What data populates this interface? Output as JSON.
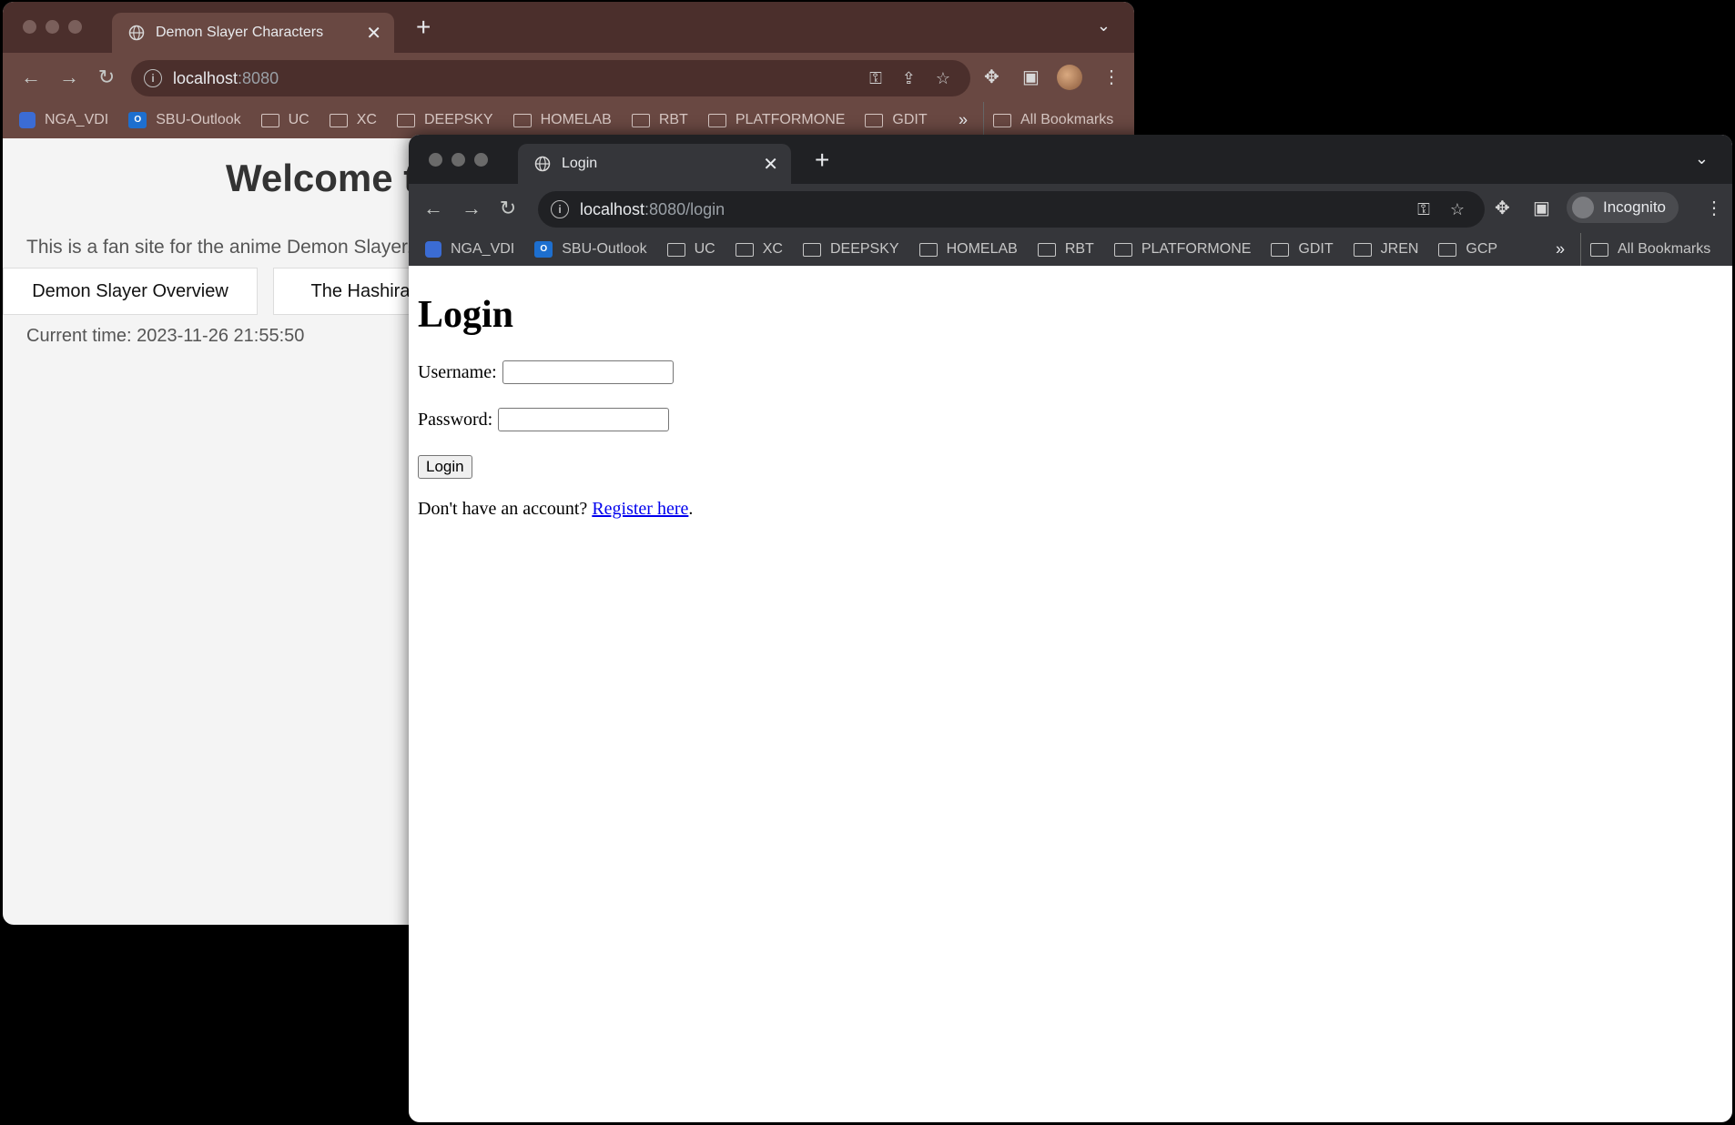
{
  "bookmarks_common": [
    "NGA_VDI",
    "SBU-Outlook",
    "UC",
    "XC",
    "DEEPSKY",
    "HOMELAB",
    "RBT",
    "PLATFORMONE",
    "GDIT"
  ],
  "back_window": {
    "tab_title": "Demon Slayer Characters",
    "url_host": "localhost",
    "url_path": ":8080",
    "all_bookmarks": "All Bookmarks",
    "page": {
      "heading": "Welcome t",
      "intro": "This is a fan site for the anime Demon Slayer.",
      "buttons": [
        "Demon Slayer Overview",
        "The Hashira"
      ],
      "time": "Current time: 2023-11-26 21:55:50"
    }
  },
  "front_window": {
    "tab_title": "Login",
    "url_host": "localhost",
    "url_path": ":8080/login",
    "incognito_label": "Incognito",
    "extra_bookmarks": [
      "JREN",
      "GCP"
    ],
    "all_bookmarks": "All Bookmarks",
    "page": {
      "heading": "Login",
      "username_label": "Username:",
      "password_label": "Password:",
      "login_button": "Login",
      "register_prompt": "Don't have an account?",
      "register_link": "Register here",
      "register_suffix": "."
    }
  }
}
